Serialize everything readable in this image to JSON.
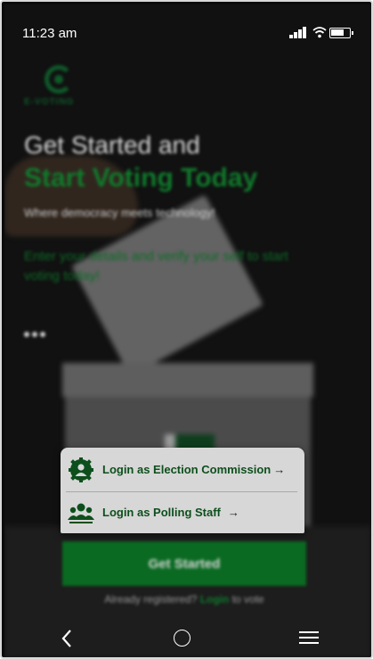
{
  "status_bar": {
    "time": "11:23 am",
    "icons": [
      "signal-icon",
      "wifi-icon",
      "battery-icon"
    ]
  },
  "brand": {
    "logo_text": "E-VOTING",
    "color": "#0f5a2a"
  },
  "hero": {
    "title_line1": "Get Started and",
    "title_line2": "Start Voting Today",
    "tagline": "Where democracy meets technology!",
    "description": "Enter your details and verify your self to start voting today!"
  },
  "login_menu": {
    "options": [
      {
        "label": "Login as Election Commission",
        "arrow": "→",
        "icon": "election-commission-icon"
      },
      {
        "label": "Login as Polling Staff",
        "arrow": "→",
        "icon": "polling-staff-icon"
      }
    ]
  },
  "cta": {
    "get_started_label": "Get Started",
    "registered_prefix": "Already registered?",
    "login_link": "Login",
    "registered_suffix": "to vote"
  },
  "nav": {
    "icons": [
      "back-icon",
      "home-icon",
      "menu-icon"
    ]
  },
  "colors": {
    "accent_green": "#0a6a22",
    "popup_bg": "#d7d7d7",
    "popup_text": "#0d4f1c"
  }
}
